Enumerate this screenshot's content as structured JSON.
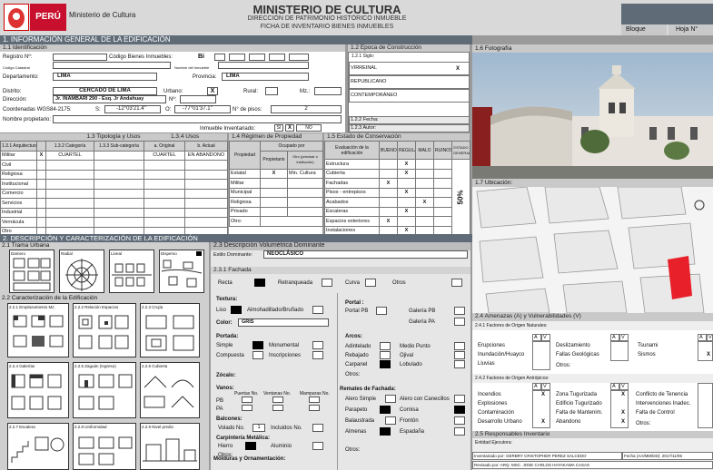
{
  "header": {
    "peru": "PERÚ",
    "ministry": "Ministerio de Cultura",
    "title": "MINISTERIO DE CULTURA",
    "subtitle": "DIRECCIÓN DE PATRIMONIO HISTÓRICO INMUEBLE",
    "form": "FICHA DE INVENTARIO BIENES INMUEBLES",
    "bloque": "Bloque",
    "hoja": "Hoja N°"
  },
  "s1": {
    "title": "1. INFORMACIÓN GENERAL DE LA EDIFICACIÓN",
    "ident": "1.1 Identificación",
    "registro": "Registro Nº:",
    "codigo": "Código Bienes Inmuebles:",
    "codigo_val": "Bi",
    "cat": "Código Catastral",
    "nombre_inm": "Nombre del Inmueble",
    "dep": "Departamento:",
    "dep_val": "LIMA",
    "prov": "Provincia:",
    "prov_val": "LIMA",
    "dist": "Distrito:",
    "dist_val": "CERCADO DE LIMA",
    "urbano": "Urbano:",
    "rural": "Rural:",
    "mz": "Mz.:",
    "dir": "Dirección:",
    "dir_val": "Jr. INAMBARI 290 - Esq. Jr Andahuay",
    "nro": "Nº:",
    "coord": "Coordenadas WGS84-2175:",
    "s": "S:",
    "s_val": "-12°03'21.4\"",
    "o": "O:",
    "o_val": "-77°01'37.1\"",
    "pisos": "N° de pisos:",
    "pisos_val": "2",
    "prop": "Nombre propietario:",
    "inv": "Inmueble Inventariado:",
    "si": "SI",
    "no": "NO",
    "x": "X"
  },
  "epoca": {
    "title": "1.2 Época de Construcción",
    "siglo": "1.2.1 Siglo:",
    "v": "VIRREINAL",
    "r": "REPUBLICANO",
    "c": "CONTEMPORÁNEO",
    "x": "X",
    "fecha": "1.2.2 Fecha:",
    "autor": "1.2.3 Autor:"
  },
  "foto": {
    "title": "1.6 Fotografía",
    "ubic": "1.7 Ubicación:"
  },
  "tip": {
    "title": "1.3 Tipología y Usos",
    "usos": "1.3.4 Usos",
    "arq": "1.3.1 Arquitectura",
    "cat": "1.3.2 Categoría",
    "sub": "1.3.3 Sub-categoría",
    "orig": "a. Original",
    "act": "b. Actual",
    "rows": [
      "Militar",
      "Civil",
      "Religiosa",
      "Institucional",
      "Comercio",
      "Servicios",
      "Industrial",
      "Vernácula",
      "Otro"
    ],
    "x": "X",
    "cat_val": "CUARTEL",
    "orig_val": "CUARTEL",
    "act_val": "EN ABANDONO"
  },
  "reg": {
    "title": "1.4 Régimen de Propiedad",
    "ocup": "Ocupado por",
    "prop": "Propiedad",
    "propietario": "Propietario",
    "otro": "Otro (precisar o institución)",
    "rows": [
      "Estatal",
      "Militar",
      "Municipal",
      "Religiosa",
      "Privado",
      "Otro:"
    ],
    "x": "X",
    "min": "Min. Cultura"
  },
  "cons": {
    "title": "1.5 Estado de Conservación",
    "eval": "Evaluación de la edificación",
    "cols": [
      "BUENO",
      "REGULAR",
      "MALO",
      "RUINOSO",
      "ESTADO GENERAL"
    ],
    "rows": [
      "Estructura",
      "Cubierta",
      "Fachadas",
      "Pisos - entrepisos",
      "Acabados",
      "Escaleras",
      "Espacios exteriores",
      "Instalaciones"
    ],
    "pct": "50%",
    "x": "X"
  },
  "s2": {
    "title": "2. DESCRIPCIÓN Y CARACTERIZACIÓN DE LA EDIFICACIÓN",
    "trama": "2.1 Trama Urbana",
    "t": [
      "Damero",
      "Radial",
      "Lineal",
      "Disperso"
    ],
    "carac": "2.2 Caracterización de la Edificación",
    "c1": "2.2.1 Emplazamiento Mz.",
    "c2": "2.2.2 Relación Espacios",
    "c3": "2.2.3 Crujía",
    "c4": "2.2.4 Galerías",
    "c5": "2.2.5 Zaguán (Ingreso)",
    "c6": "2.2.6 Cubierta",
    "c7": "2.2.7 Escalera",
    "c8": "2.2.8 Uniformidad",
    "c9": "2.2.9 Nivel predio"
  },
  "vol": {
    "title": "2.3 Descripción Volumétrica Dominante",
    "estilo": "Estilo Dominante:",
    "estilo_val": "NEOCLÁSICO",
    "fachada": "2.3.1 Fachada",
    "recta": "Recta",
    "retr": "Retranqueada",
    "curva": "Curva",
    "otros": "Otros",
    "textura": "Textura:",
    "liso": "Liso",
    "almo": "Almohadillado/Bruñado",
    "portal": "Portal :",
    "portal_pb": "Portal PB",
    "gal_pb": "Galería PB",
    "gal_pa": "Galería PA",
    "color": "Color:",
    "color_val": "GRIS",
    "portada": "Portada:",
    "simple": "Simple",
    "monumental": "Monumental",
    "compuesta": "Compuesta",
    "inscr": "Inscripciones",
    "arcos": "Arcos:",
    "adintelado": "Adintelado",
    "medio": "Medio Punto",
    "rebajado": "Rebajado",
    "ojival": "Ojival",
    "carpanel": "Carpanel",
    "lobulado": "Lobulado",
    "otros2": "Otros:",
    "zocalo": "Zócalo:",
    "vanos": "Vanos:",
    "puertas": "Puertas No.",
    "ventanas": "Ventanas No.",
    "mamparas": "Mamparas No.",
    "pb": "PB",
    "pa": "PA",
    "balcones": "Balcones:",
    "volado": "Volado No.",
    "volado_val": "1",
    "incluidos": "Incluidos No.",
    "remates": "Remates de Fachada:",
    "alero": "Alero Simple",
    "alero_c": "Alero con Canecillos",
    "parapeto": "Parapeto",
    "cornisa": "Cornisa",
    "balaustrada": "Balaustrada",
    "fronton": "Frontón",
    "almenas": "Almenas",
    "espadana": "Espadaña",
    "carp": "Carpintería Metálica:",
    "hierro": "Hierro",
    "aluminio": "Aluminio",
    "otros3": "Otros:",
    "molduras": "Molduras y Ornamentación:"
  },
  "s24": {
    "title": "2.4 Amenazas (A) y Vulnerabilidades (V)",
    "nat": "2.4.1 Factores de Origen Naturales:",
    "av": "A",
    "vv": "V",
    "n1": [
      "Erupciones",
      "Inundación/Huayco",
      "Lluvias"
    ],
    "n2": [
      "Deslizamiento",
      "Fallas Geológicas",
      "Otros:"
    ],
    "n3": [
      "Tsunami",
      "Sismos"
    ],
    "ant": "2.4.2 Factores de Origen Antrópicos:",
    "a1": [
      "Incendios",
      "Explosiones",
      "Contaminación",
      "Desarrollo Urbano"
    ],
    "a2": [
      "Zona Tugurizada",
      "Edificio Tugurizado",
      "Falta de Mantenim.",
      "Abandono"
    ],
    "a3": [
      "Conflicto de Tenencia",
      "Intervenciones Inadec.",
      "Falta de Control",
      "Otros:"
    ],
    "x": "X"
  },
  "s25": {
    "title": "2.5 Responsables Inventario",
    "ent": "Entidad Ejecutora:",
    "inv": "Inventariado por:  GERBRY CRISTOPHER PEREZ SALCEDO",
    "fecha": "Fecha (AA/MM/DD): 2017/11/06",
    "rev": "Revisado por: ARQ. MSC. JOSE CARLOS HAYAKAWA CASAS"
  }
}
